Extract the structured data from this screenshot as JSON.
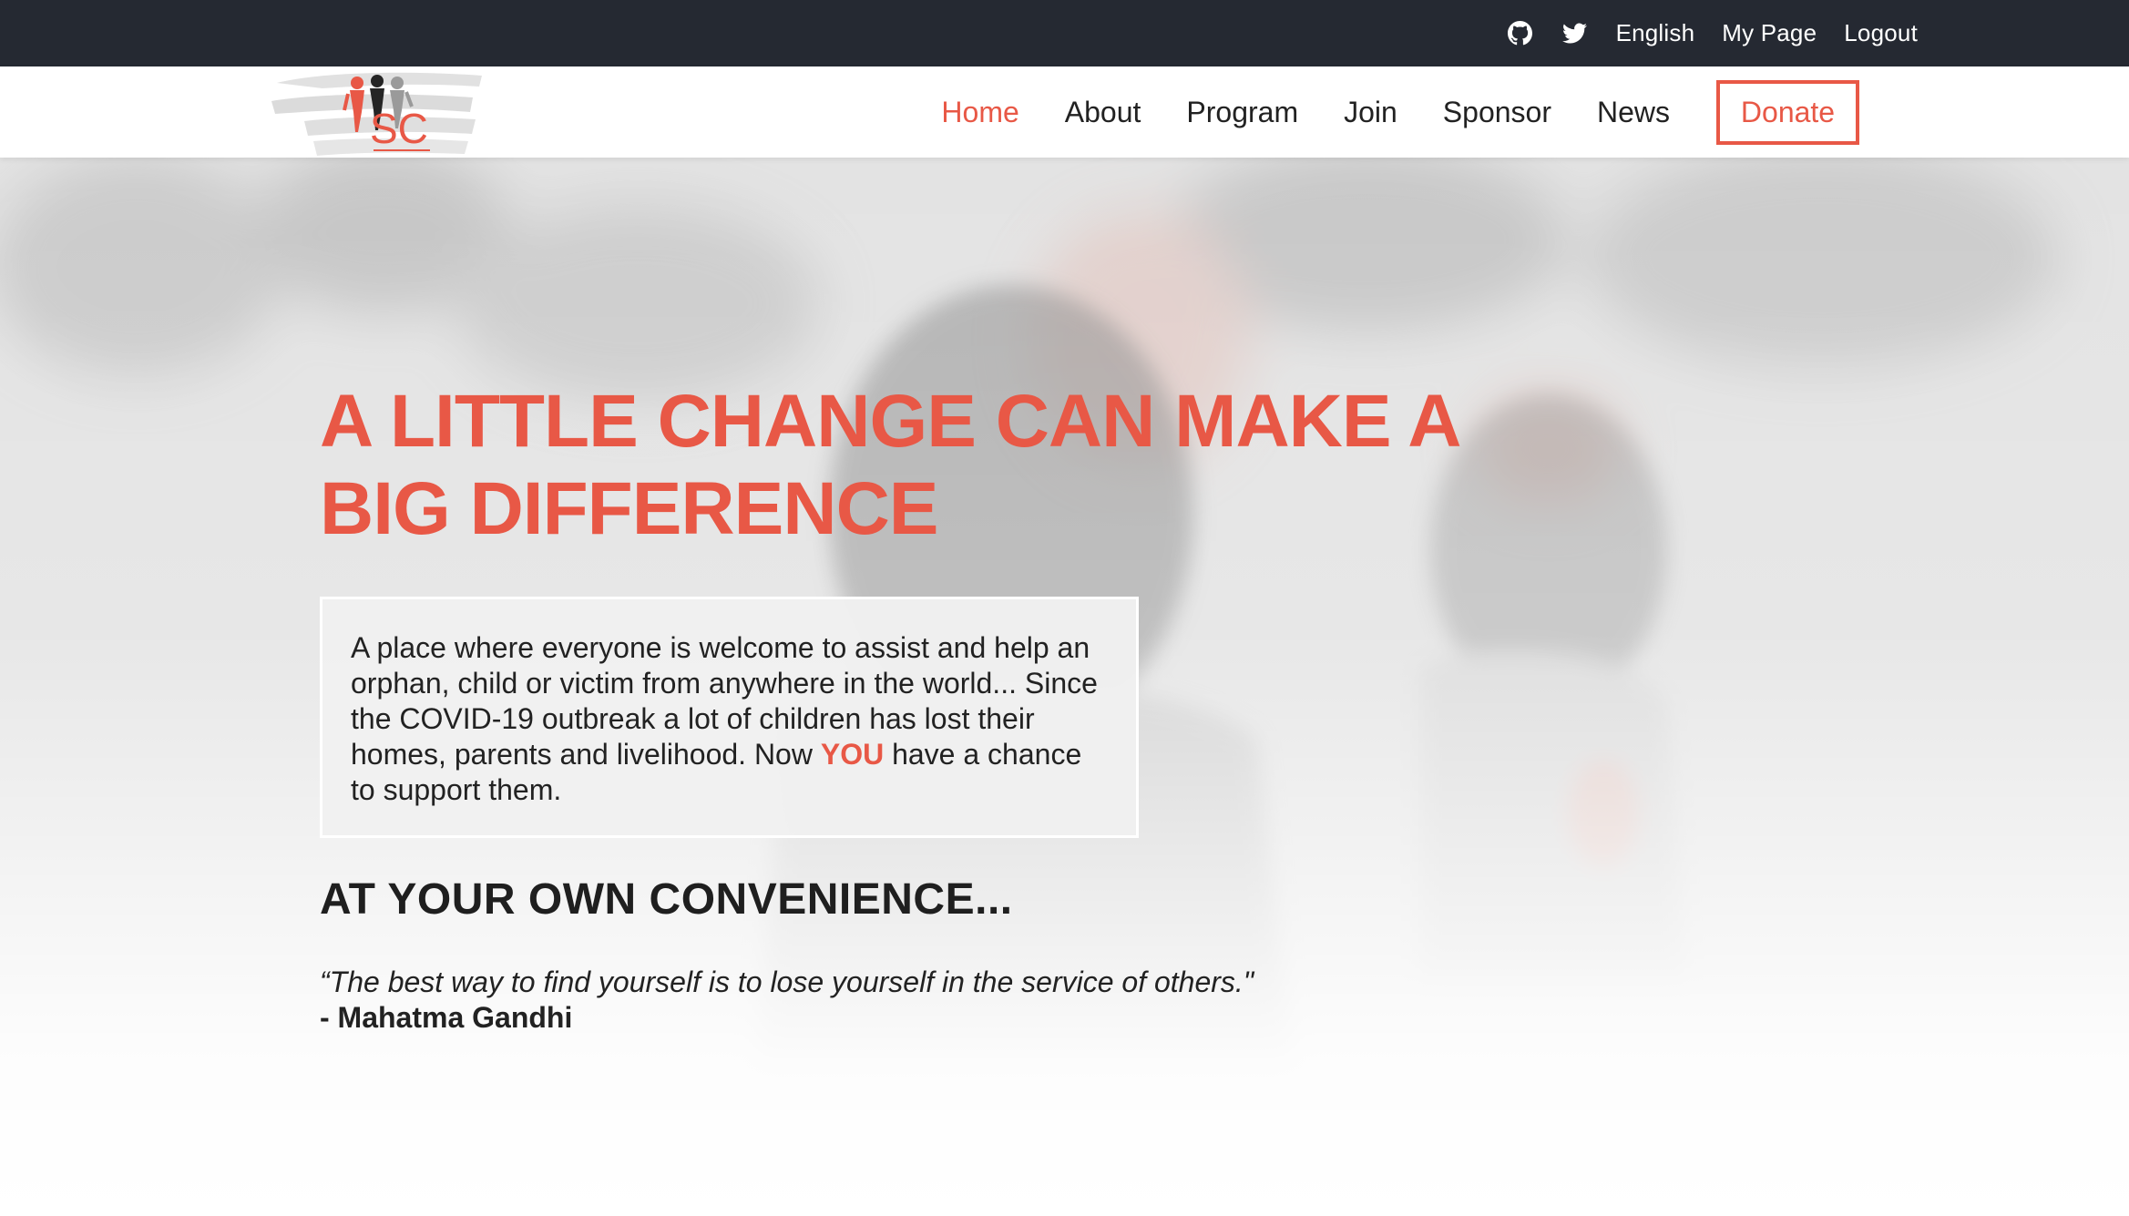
{
  "topbar": {
    "icons": [
      "github-icon",
      "twitter-icon"
    ],
    "language": "English",
    "my_page": "My Page",
    "logout": "Logout"
  },
  "logo": {
    "text": "SC"
  },
  "nav": {
    "items": [
      {
        "label": "Home",
        "active": true
      },
      {
        "label": "About",
        "active": false
      },
      {
        "label": "Program",
        "active": false
      },
      {
        "label": "Join",
        "active": false
      },
      {
        "label": "Sponsor",
        "active": false
      },
      {
        "label": "News",
        "active": false
      }
    ],
    "donate": "Donate"
  },
  "hero": {
    "title": "A LITTLE CHANGE CAN MAKE A BIG DIFFERENCE",
    "intro_before": "A place where everyone is welcome to assist and help an orphan, child or victim from anywhere in the world... Since the COVID-19 outbreak a lot of children has lost their homes, parents and livelihood. Now ",
    "intro_highlight": "YOU",
    "intro_after": " have a chance to support them.",
    "subheading": "AT YOUR OWN CONVENIENCE...",
    "quote": "“The best way to find yourself is to lose yourself in the service of others.\"",
    "quote_author": "- Mahatma Gandhi"
  },
  "colors": {
    "accent": "#e85846",
    "topbar_bg": "#252932",
    "text": "#222222"
  }
}
